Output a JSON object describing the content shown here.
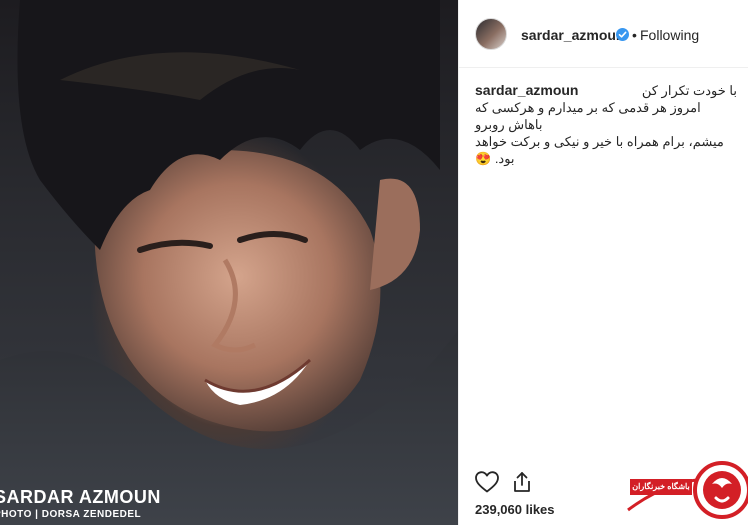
{
  "post": {
    "photo_watermark_name": "SARDAR AZMOUN",
    "photo_watermark_credit": "PHOTO | DORSA ZENDEDEL"
  },
  "header": {
    "username": "sardar_azmoun",
    "separator": "•",
    "follow_status": "Following"
  },
  "caption": {
    "username": "sardar_azmoun",
    "line1": "با خودت تکرار کن",
    "line2": "امروز هر قدمی که بر میدارم و هرکسی که باهاش روبرو",
    "line3": "میشم، برام همراه با خیر و نیکی و برکت خواهد بود.",
    "emoji": "😍"
  },
  "actions": {
    "like_icon": "heart-icon",
    "share_icon": "share-icon"
  },
  "likes": {
    "text": "239,060 likes"
  },
  "site_logo": {
    "label": "باشگاه خبرنگاران"
  },
  "colors": {
    "verified_badge": "#3897f0",
    "logo_red": "#d31f26",
    "text": "#262626"
  }
}
